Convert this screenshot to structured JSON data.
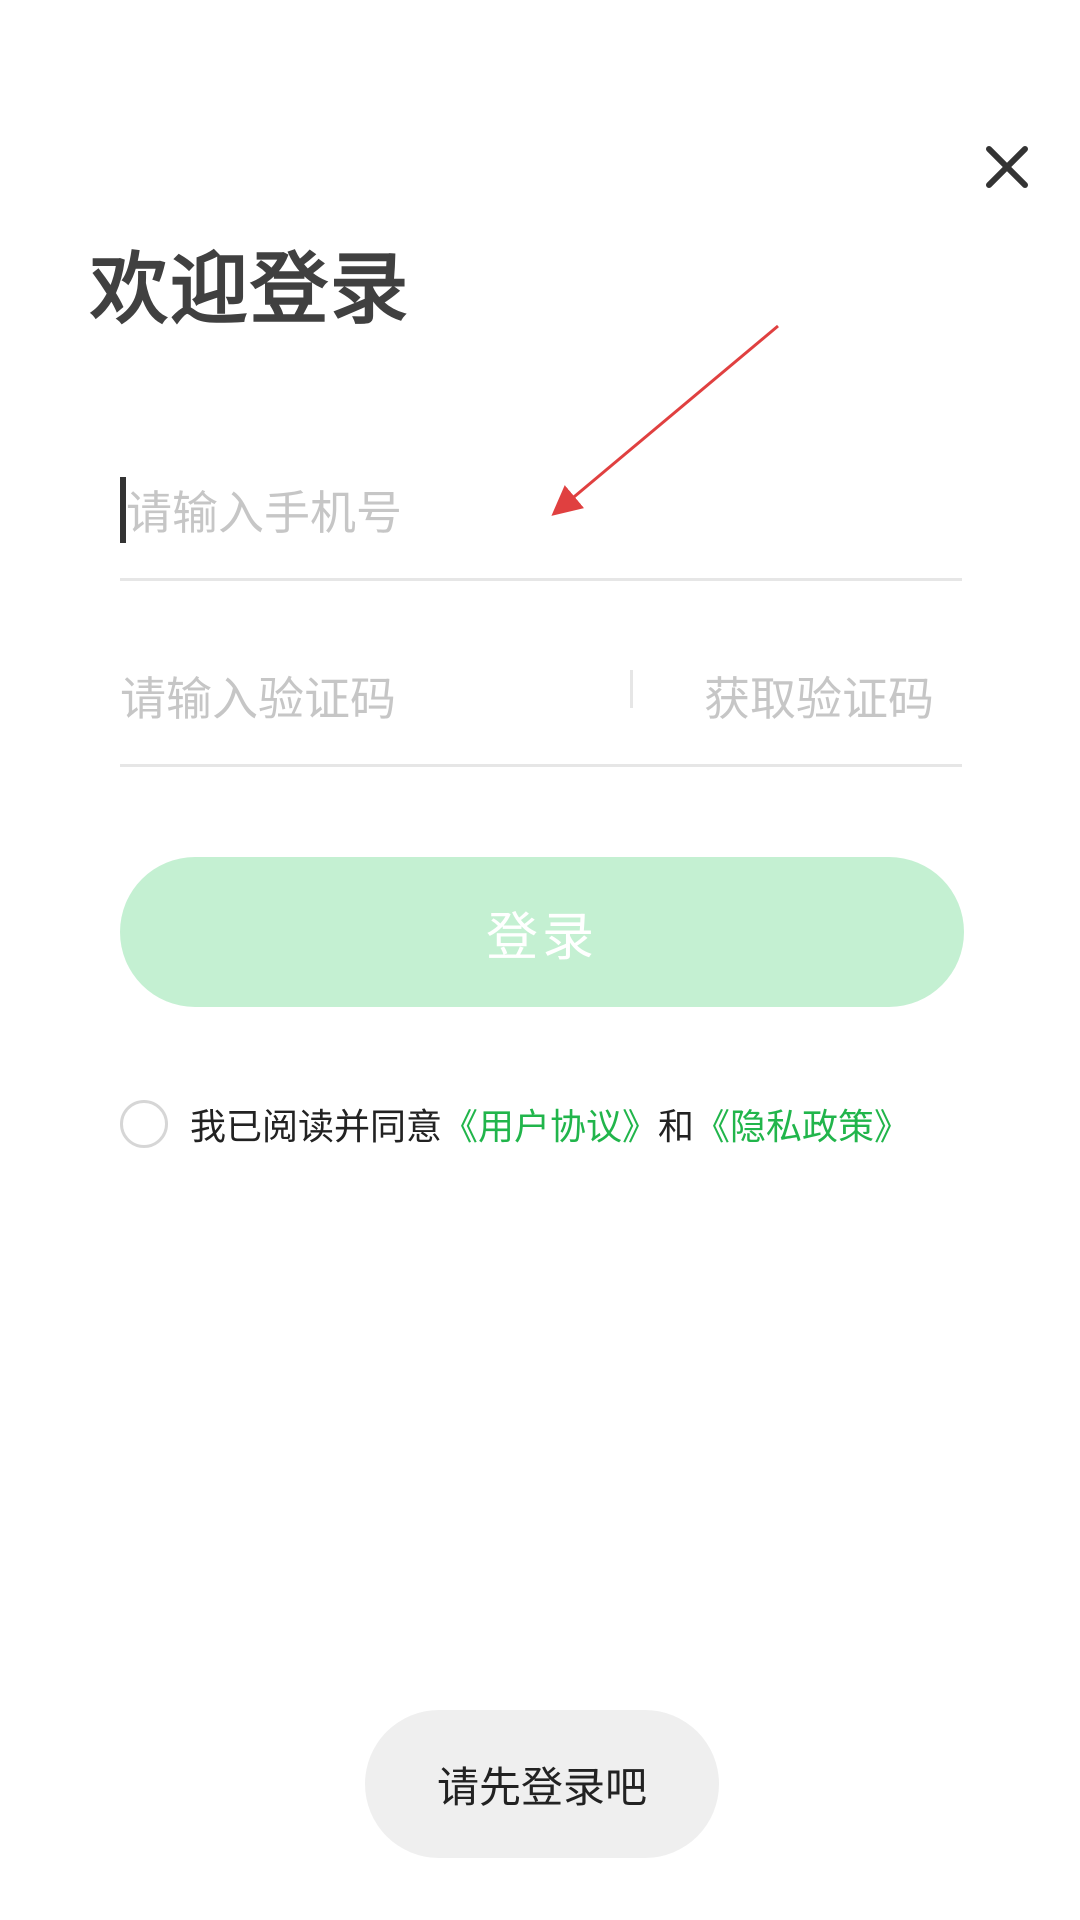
{
  "header": {
    "close_icon": "close-icon"
  },
  "title": "欢迎登录",
  "phone": {
    "placeholder": "请输入手机号",
    "value": ""
  },
  "code": {
    "placeholder": "请输入验证码",
    "value": "",
    "get_code_label": "获取验证码"
  },
  "login_button": {
    "label": "登录",
    "color": "#c4f0d2"
  },
  "agreement": {
    "checked": false,
    "prefix": "我已阅读并同意",
    "user_agreement": "《用户协议》",
    "connector": "和",
    "privacy_policy": "《隐私政策》",
    "link_color": "#21b54b"
  },
  "toast": {
    "message": "请先登录吧"
  },
  "annotation": {
    "color": "#e04040"
  }
}
